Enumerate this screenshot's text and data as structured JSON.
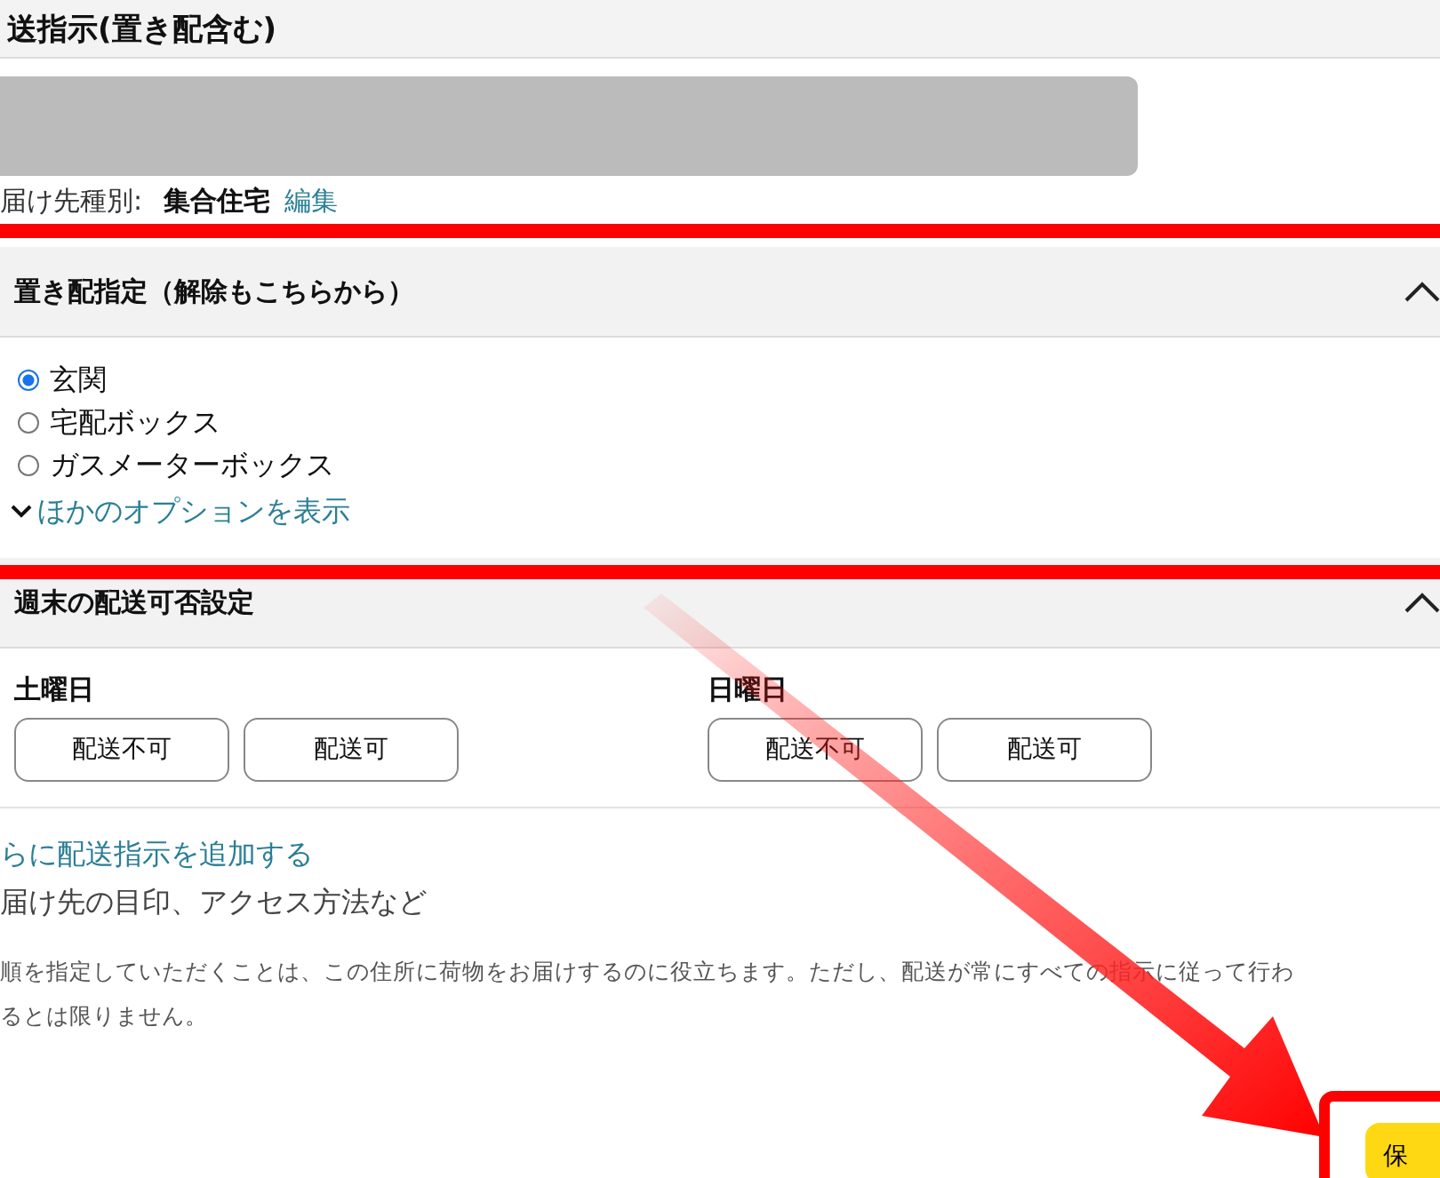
{
  "page_title": "送指示(置き配含む)",
  "address": {
    "type_label": "届け先種別:",
    "type_value": "集合住宅",
    "edit_link": "編集"
  },
  "dropoff": {
    "title": "置き配指定（解除もこちらから）",
    "expanded": true,
    "options": [
      {
        "label": "玄関",
        "selected": true
      },
      {
        "label": "宅配ボックス",
        "selected": false
      },
      {
        "label": "ガスメーターボックス",
        "selected": false
      }
    ],
    "more_link": "ほかのオプションを表示"
  },
  "weekend": {
    "title": "週末の配送可否設定",
    "expanded": true,
    "days": [
      {
        "label": "土曜日",
        "buttons": [
          {
            "label": "配送不可",
            "selected": false
          },
          {
            "label": "配送可",
            "selected": false
          }
        ]
      },
      {
        "label": "日曜日",
        "buttons": [
          {
            "label": "配送不可",
            "selected": false
          },
          {
            "label": "配送可",
            "selected": false
          }
        ]
      }
    ]
  },
  "add_link": "らに配送指示を追加する",
  "add_hint": "届け先の目印、アクセス方法など",
  "note_lines": [
    "順を指定していただくことは、この住所に荷物をお届けするのに役立ちます。ただし、配送が常にすべての指示に従って行わ",
    "るとは限りません。"
  ],
  "save_button": "保"
}
